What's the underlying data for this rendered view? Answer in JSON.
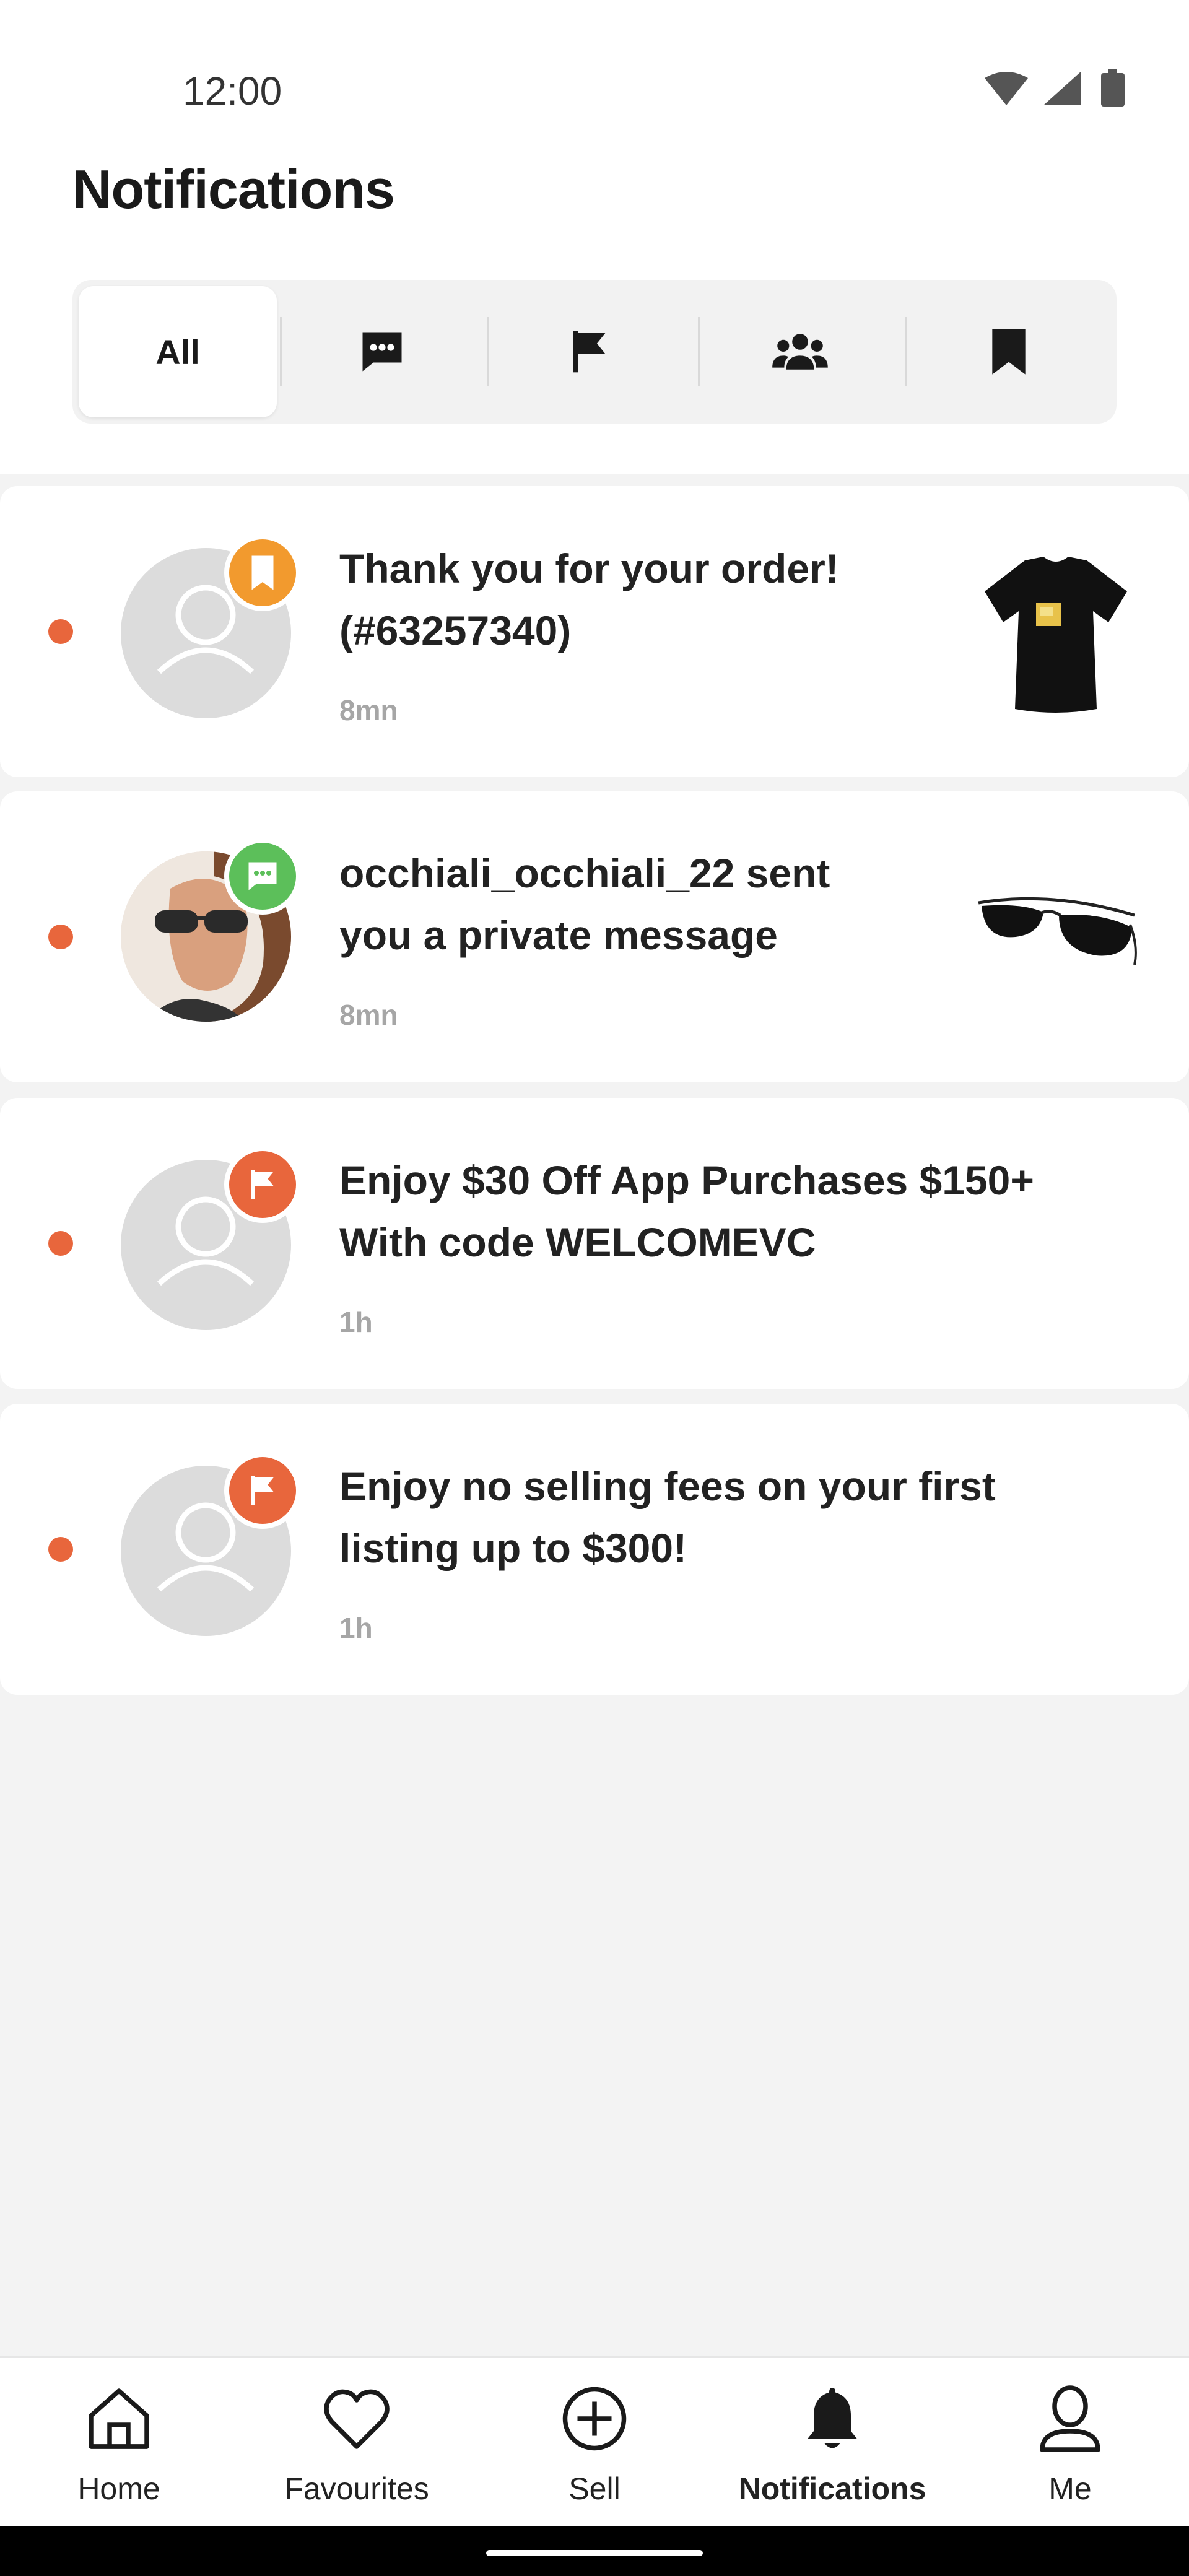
{
  "status_bar": {
    "time": "12:00",
    "icons": [
      "wifi-icon",
      "cellular-signal-icon",
      "battery-icon"
    ]
  },
  "page": {
    "title": "Notifications"
  },
  "filter_tabs": [
    {
      "label": "All",
      "icon": "",
      "active": true
    },
    {
      "label": "",
      "icon": "chat-bubble-icon",
      "active": false
    },
    {
      "label": "",
      "icon": "flag-icon",
      "active": false
    },
    {
      "label": "",
      "icon": "group-icon",
      "active": false
    },
    {
      "label": "",
      "icon": "bookmark-icon",
      "active": false
    }
  ],
  "notifications": [
    {
      "title_line1": "Thank you for your order!",
      "title_line2": "(#63257340)",
      "time": "8mn",
      "badge_icon": "bookmark-icon",
      "badge_color": "#f29a2e",
      "avatar": "default-avatar",
      "thumbnail": "black-tshirt",
      "unread": true
    },
    {
      "title_line1": "occhiali_occhiali_22 sent",
      "title_line2": "you a private message",
      "time": "8mn",
      "badge_icon": "chat-bubble-icon",
      "badge_color": "#5cbf5a",
      "avatar": "user-photo",
      "thumbnail": "aviator-sunglasses",
      "unread": true
    },
    {
      "title_line1": "Enjoy $30 Off App Purchases $150+",
      "title_line2": "With code WELCOMEVC",
      "time": "1h",
      "badge_icon": "flag-icon",
      "badge_color": "#e8663c",
      "avatar": "default-avatar",
      "thumbnail": "",
      "unread": true
    },
    {
      "title_line1": "Enjoy no selling fees on your first",
      "title_line2": "listing up to $300!",
      "time": "1h",
      "badge_icon": "flag-icon",
      "badge_color": "#e8663c",
      "avatar": "default-avatar",
      "thumbnail": "",
      "unread": true
    }
  ],
  "bottom_nav": [
    {
      "label": "Home",
      "icon": "home-icon",
      "active": false
    },
    {
      "label": "Favourites",
      "icon": "heart-icon",
      "active": false
    },
    {
      "label": "Sell",
      "icon": "plus-circle-icon",
      "active": false
    },
    {
      "label": "Notifications",
      "icon": "bell-icon",
      "active": true
    },
    {
      "label": "Me",
      "icon": "person-icon",
      "active": false
    }
  ],
  "colors": {
    "accent": "#e8663c",
    "order_badge": "#f29a2e",
    "message_badge": "#5cbf5a",
    "background": "#f3f3f3",
    "card": "#ffffff",
    "muted_text": "#a6a6a6"
  }
}
